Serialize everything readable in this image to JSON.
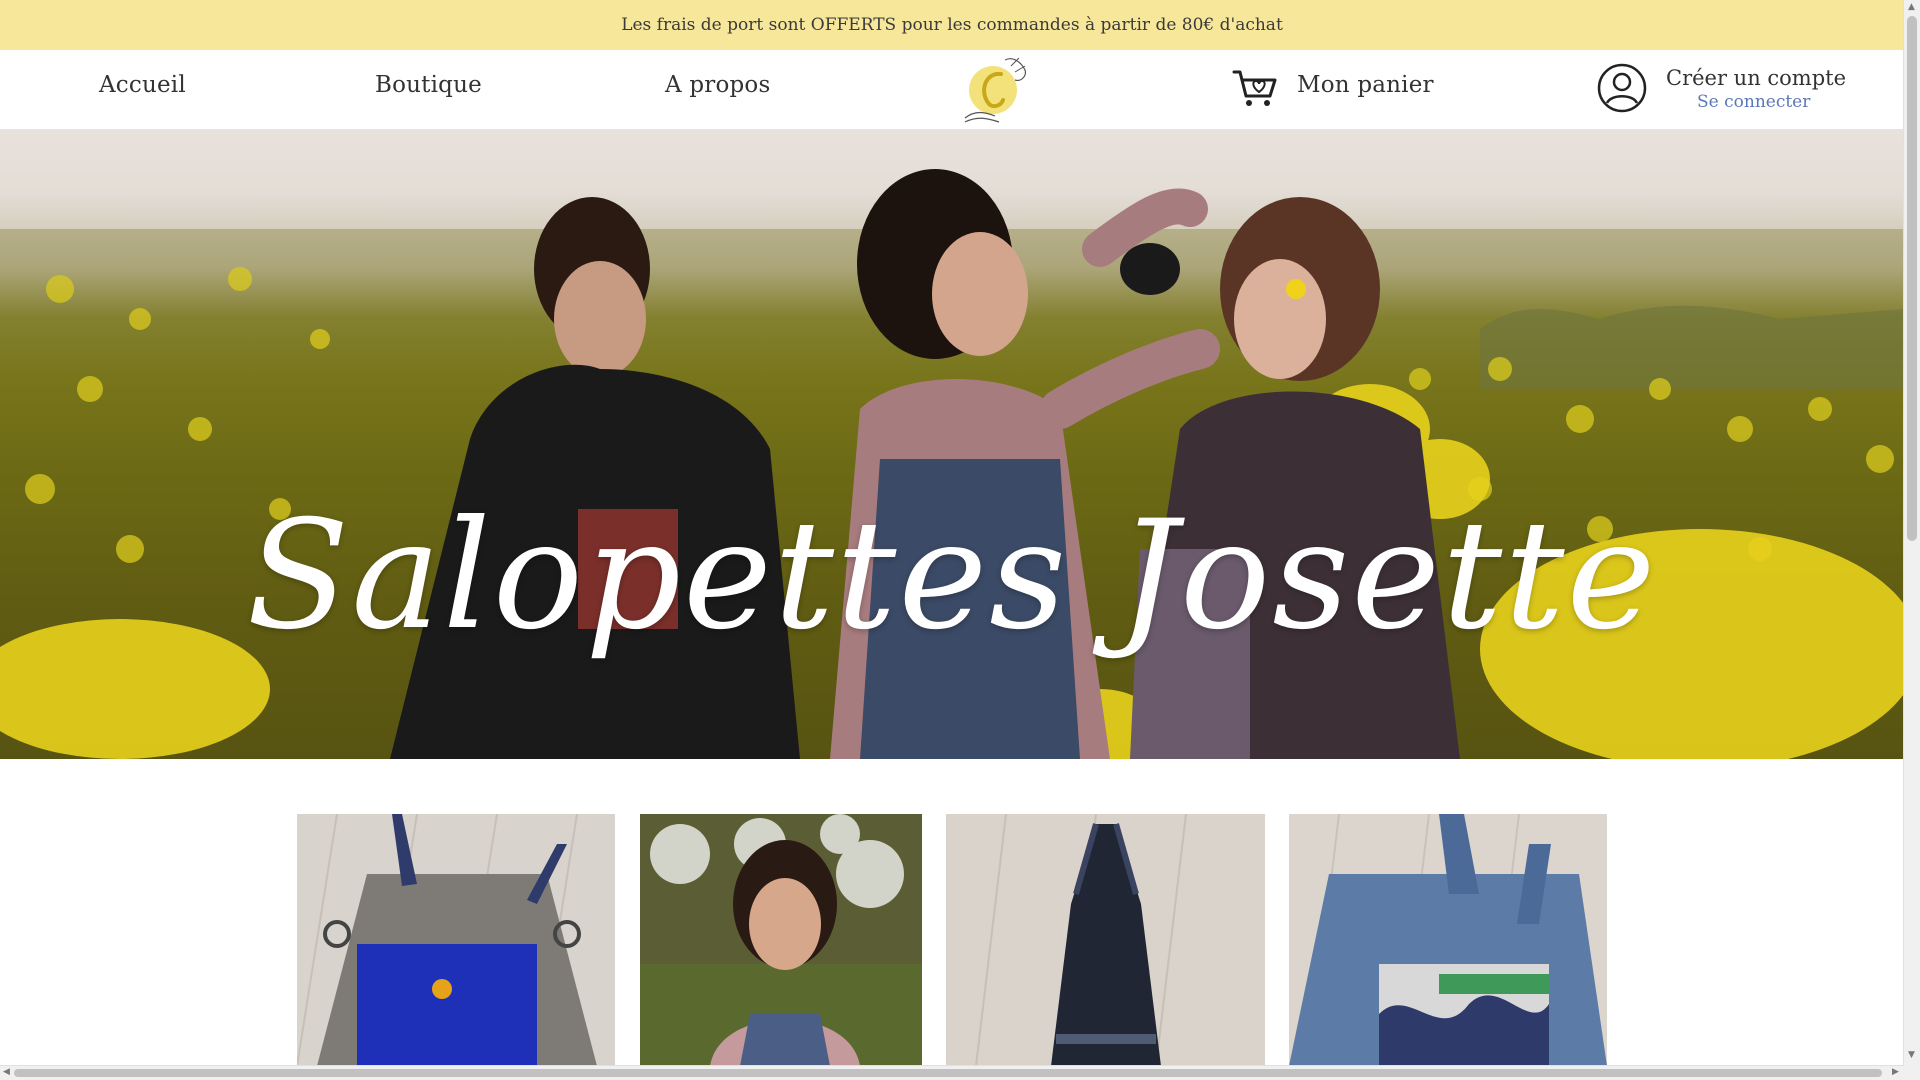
{
  "announcement": "Les frais de port sont OFFERTS pour les commandes à partir de 80€ d'achat",
  "nav": {
    "home": "Accueil",
    "shop": "Boutique",
    "about": "A propos",
    "cart": "Mon panier"
  },
  "account": {
    "create": "Créer un compte",
    "login": "Se connecter"
  },
  "hero": {
    "title": "Salopettes Josette"
  },
  "icons": {
    "logo": "logo-icon",
    "cart": "cart-icon",
    "account": "user-circle-icon"
  },
  "colors": {
    "announcement_bg": "#f7e79a",
    "link_blue": "#5a78b5",
    "flower_yellow": "#e8d21c"
  },
  "products": [
    {
      "name": "product-grey-blue-pocket"
    },
    {
      "name": "product-woman-denim"
    },
    {
      "name": "product-black-halter"
    },
    {
      "name": "product-denim-wave-pocket"
    }
  ]
}
